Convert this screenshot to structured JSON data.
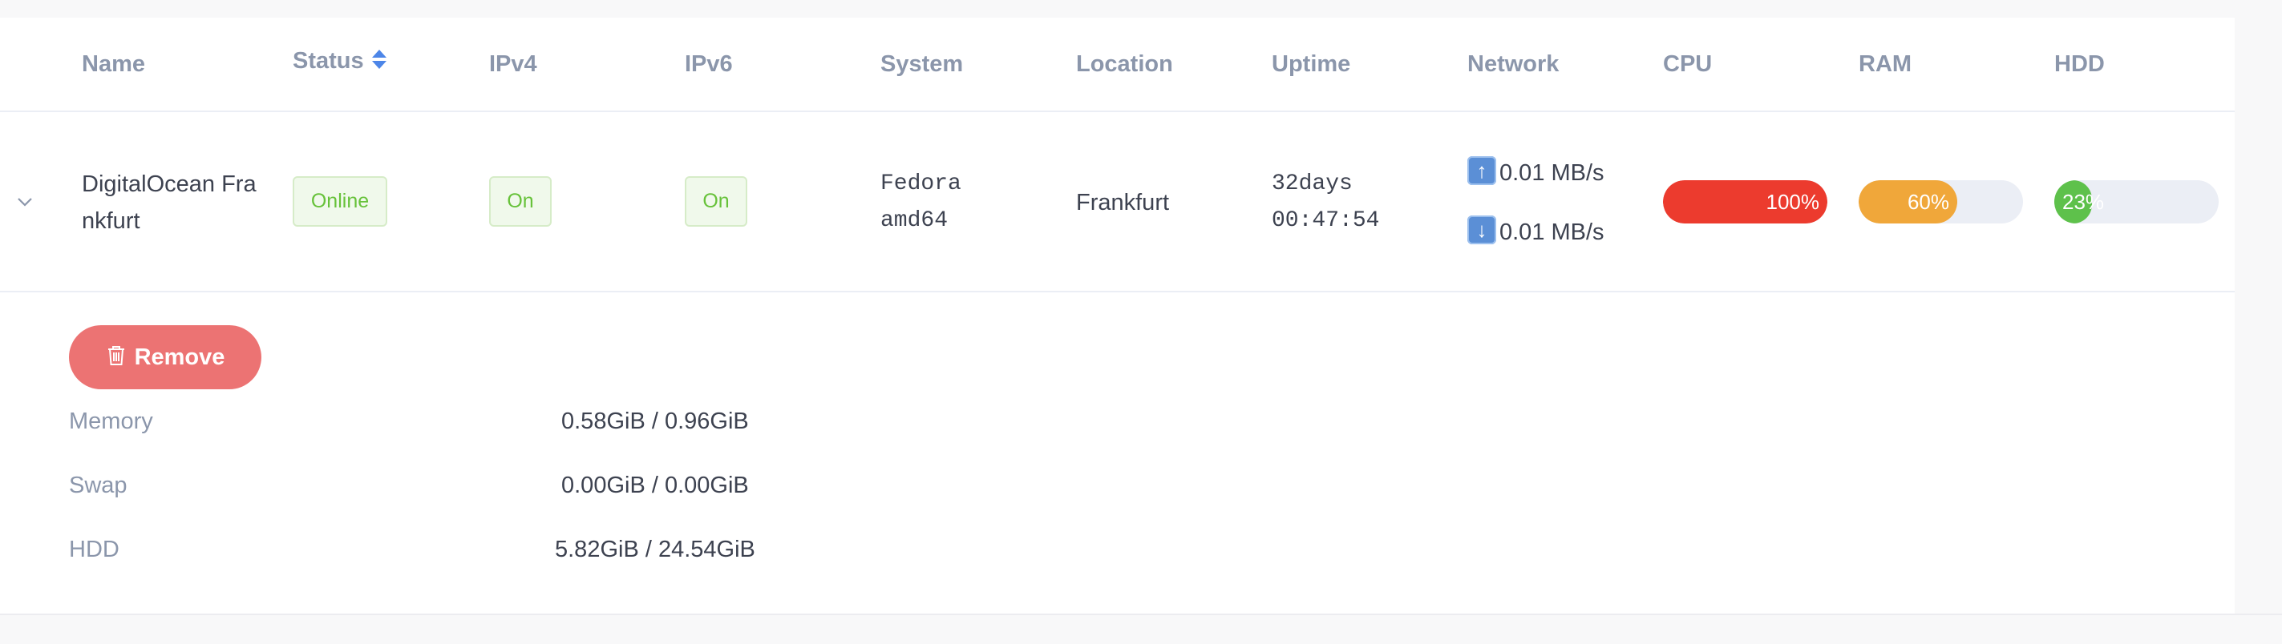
{
  "table": {
    "headers": {
      "name": "Name",
      "status": "Status",
      "ipv4": "IPv4",
      "ipv6": "IPv6",
      "system": "System",
      "location": "Location",
      "uptime": "Uptime",
      "network": "Network",
      "cpu": "CPU",
      "ram": "RAM",
      "hdd": "HDD"
    },
    "row": {
      "name_line1": "DigitalOcean Fra",
      "name_line2": "nkfurt",
      "status": "Online",
      "ipv4": "On",
      "ipv6": "On",
      "system_line1": "Fedora",
      "system_line2": "amd64",
      "location": "Frankfurt",
      "uptime_line1": "32days",
      "uptime_line2": "00:47:54",
      "network_up": "0.01 MB/s",
      "network_down": "0.01 MB/s",
      "cpu": {
        "label": "100%",
        "percent": 100,
        "color": "#ec3b2e"
      },
      "ram": {
        "label": "60%",
        "percent": 60,
        "color": "#f0a73a"
      },
      "hdd": {
        "label": "23%",
        "percent": 23,
        "color": "#5ec14b"
      }
    }
  },
  "details": {
    "remove_label": "Remove",
    "items": [
      {
        "label": "Memory",
        "value": "0.58GiB / 0.96GiB"
      },
      {
        "label": "Swap",
        "value": "0.00GiB / 0.00GiB"
      },
      {
        "label": "HDD",
        "value": "5.82GiB / 24.54GiB"
      }
    ]
  },
  "icons": {
    "sort": "sort-icon",
    "expand": "chevron-down-icon",
    "upload": "arrow-up-icon",
    "download": "arrow-down-icon",
    "trash": "trash-icon"
  }
}
